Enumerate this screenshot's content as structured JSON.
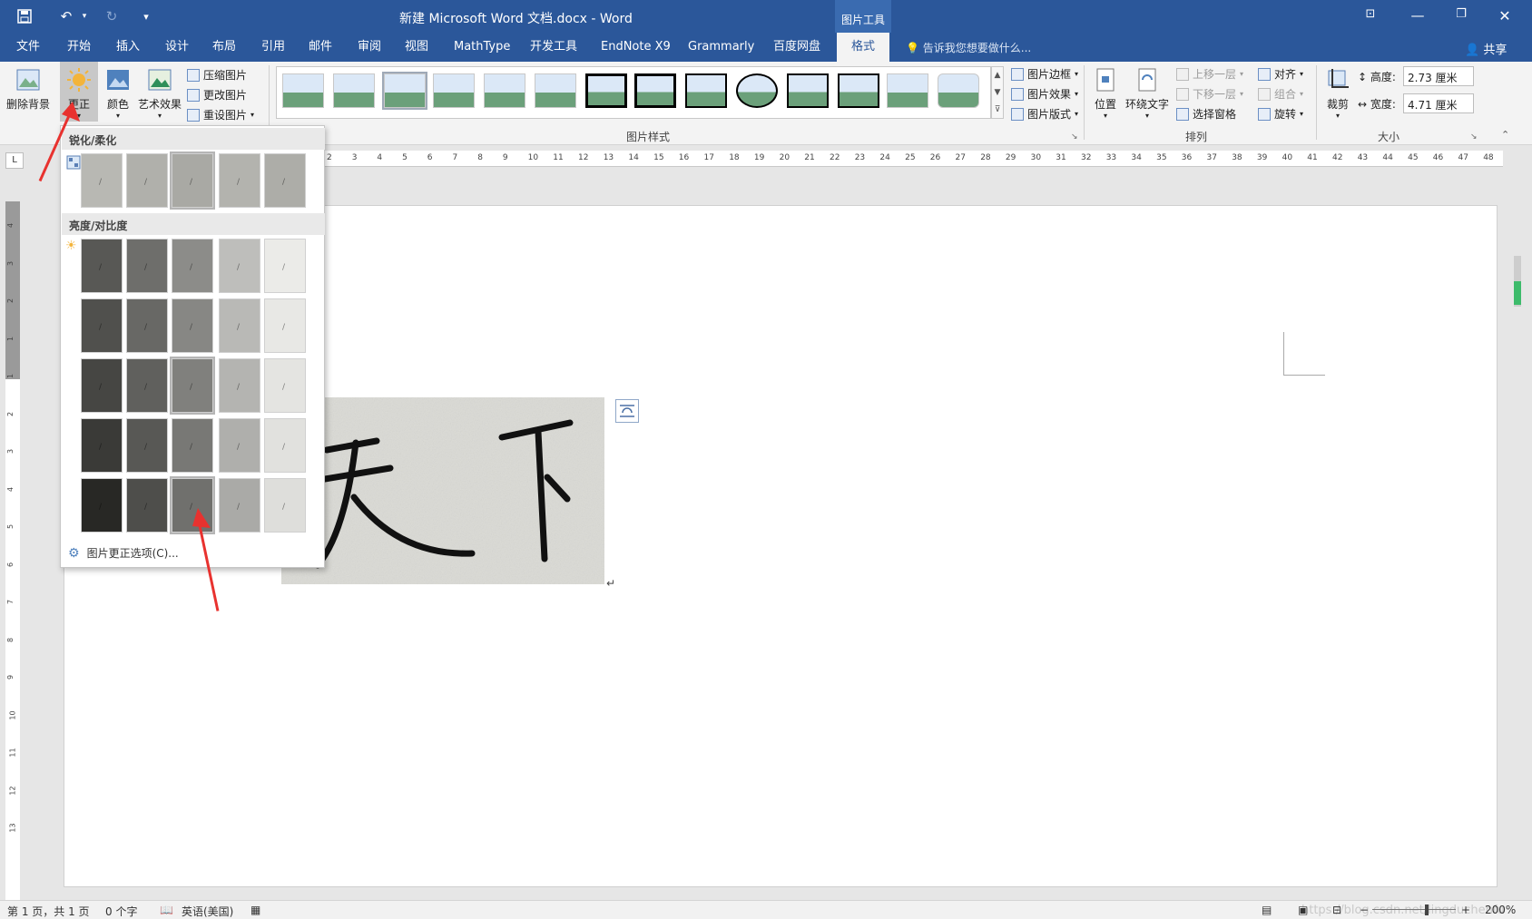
{
  "titlebar": {
    "title": "新建 Microsoft Word 文档.docx - Word",
    "context_tab_label": "图片工具",
    "save_icon": "save-icon",
    "undo_icon": "undo-icon",
    "redo_icon": "redo-icon"
  },
  "tabs": {
    "items": [
      "文件",
      "开始",
      "插入",
      "设计",
      "布局",
      "引用",
      "邮件",
      "审阅",
      "视图",
      "MathType",
      "开发工具",
      "EndNote X9",
      "Grammarly",
      "百度网盘",
      "格式"
    ],
    "active": "格式",
    "tell_me": "告诉我您想要做什么...",
    "share": "共享"
  },
  "ribbon": {
    "remove_bg": "删除背景",
    "corrections": "更正",
    "color": "颜色",
    "artistic": "艺术效果",
    "compress": "压缩图片",
    "change": "更改图片",
    "reset": "重设图片",
    "styles_group": "图片样式",
    "border": "图片边框",
    "effects": "图片效果",
    "layout": "图片版式",
    "position": "位置",
    "wrap_text": "环绕文字",
    "bring_forward": "上移一层",
    "send_backward": "下移一层",
    "selection_pane": "选择窗格",
    "align": "对齐",
    "group": "组合",
    "rotate": "旋转",
    "arrange_group": "排列",
    "crop": "裁剪",
    "height_label": "高度:",
    "height_value": "2.73 厘米",
    "width_label": "宽度:",
    "width_value": "4.71 厘米",
    "size_group": "大小"
  },
  "ruler": {
    "corner": "L",
    "h_ticks": [
      "2",
      "3",
      "4",
      "5",
      "6",
      "7",
      "8",
      "9",
      "10",
      "11",
      "12",
      "13",
      "14",
      "15",
      "16",
      "17",
      "18",
      "19",
      "20",
      "21",
      "22",
      "23",
      "24",
      "25",
      "26",
      "27",
      "28",
      "29",
      "30",
      "31",
      "32",
      "33",
      "34",
      "35",
      "36",
      "37",
      "38",
      "39",
      "40",
      "41",
      "42",
      "43",
      "44",
      "45",
      "46",
      "47",
      "48"
    ],
    "v_ticks": [
      "4",
      "3",
      "2",
      "1",
      "1",
      "2",
      "3",
      "4",
      "5",
      "6",
      "7",
      "8",
      "9",
      "10",
      "11",
      "12",
      "13"
    ]
  },
  "corrections_panel": {
    "sharpen_header": "锐化/柔化",
    "brightness_header": "亮度/对比度",
    "options_label": "图片更正选项(C)...",
    "sharpen_selected_index": 2,
    "brightness_selected": {
      "row": 2,
      "col": 2
    }
  },
  "document": {
    "paragraph_mark": "↵",
    "image_text": "天 下"
  },
  "statusbar": {
    "page": "第 1 页，共 1 页",
    "words": "0 个字",
    "language": "英语(美国)",
    "zoom": "200%",
    "watermark": "https://blog.csdn.net/lingduchenfu"
  },
  "colors": {
    "word_blue": "#2b579a",
    "ribbon_bg": "#f3f3f3",
    "arrow_red": "#e8322f"
  }
}
